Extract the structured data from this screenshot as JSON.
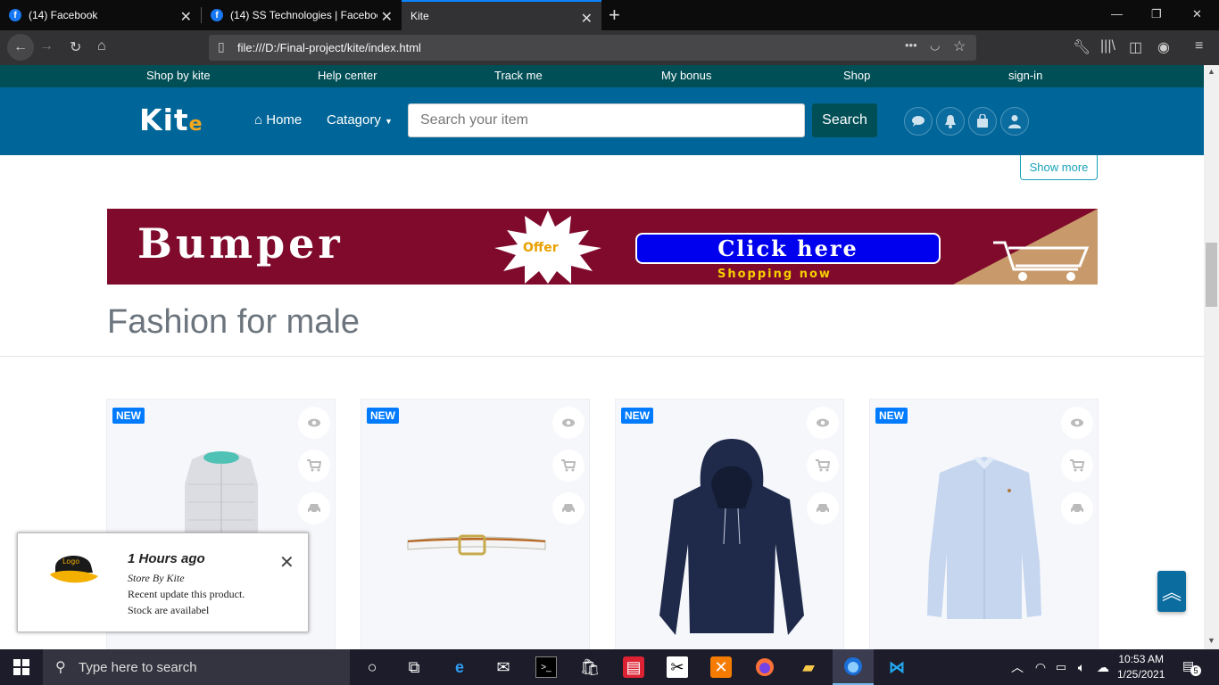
{
  "browser": {
    "tabs": [
      {
        "label": "(14) Facebook",
        "icon": "facebook-icon"
      },
      {
        "label": "(14) SS Technologies | Faceboo",
        "icon": "facebook-icon"
      },
      {
        "label": "Kite",
        "icon": ""
      }
    ],
    "url": "file:///D:/Final-project/kite/index.html"
  },
  "topstrip": {
    "links": [
      "Shop by kite",
      "Help center",
      "Track me",
      "My bonus",
      "Shop",
      "sign-in"
    ]
  },
  "header": {
    "logo_text": "Kit",
    "logo_e": "e",
    "home_label": "Home",
    "category_label": "Catagory",
    "search_placeholder": "Search your item",
    "search_button": "Search"
  },
  "content": {
    "show_more": "Show more",
    "banner": {
      "bumper": "Bumper",
      "offer": "Offer",
      "click_here": "Click here",
      "shopping_now": "Shopping now"
    },
    "section_title": "Fashion for male",
    "products": [
      {
        "badge": "NEW",
        "item": "vest"
      },
      {
        "badge": "NEW",
        "item": "belt"
      },
      {
        "badge": "NEW",
        "item": "hoodie"
      },
      {
        "badge": "NEW",
        "item": "shirt"
      }
    ]
  },
  "notification": {
    "time": "1 Hours ago",
    "store": "Store By Kite",
    "line1": "Recent  update  this  product.",
    "line2": "Stock are availabel"
  },
  "taskbar": {
    "search_placeholder": "Type here to search",
    "time": "10:53 AM",
    "date": "1/25/2021",
    "notifications": "5"
  },
  "colors": {
    "header": "#006699",
    "topstrip": "#004f56",
    "badge": "#007bff",
    "banner": "#7f0a2c"
  }
}
